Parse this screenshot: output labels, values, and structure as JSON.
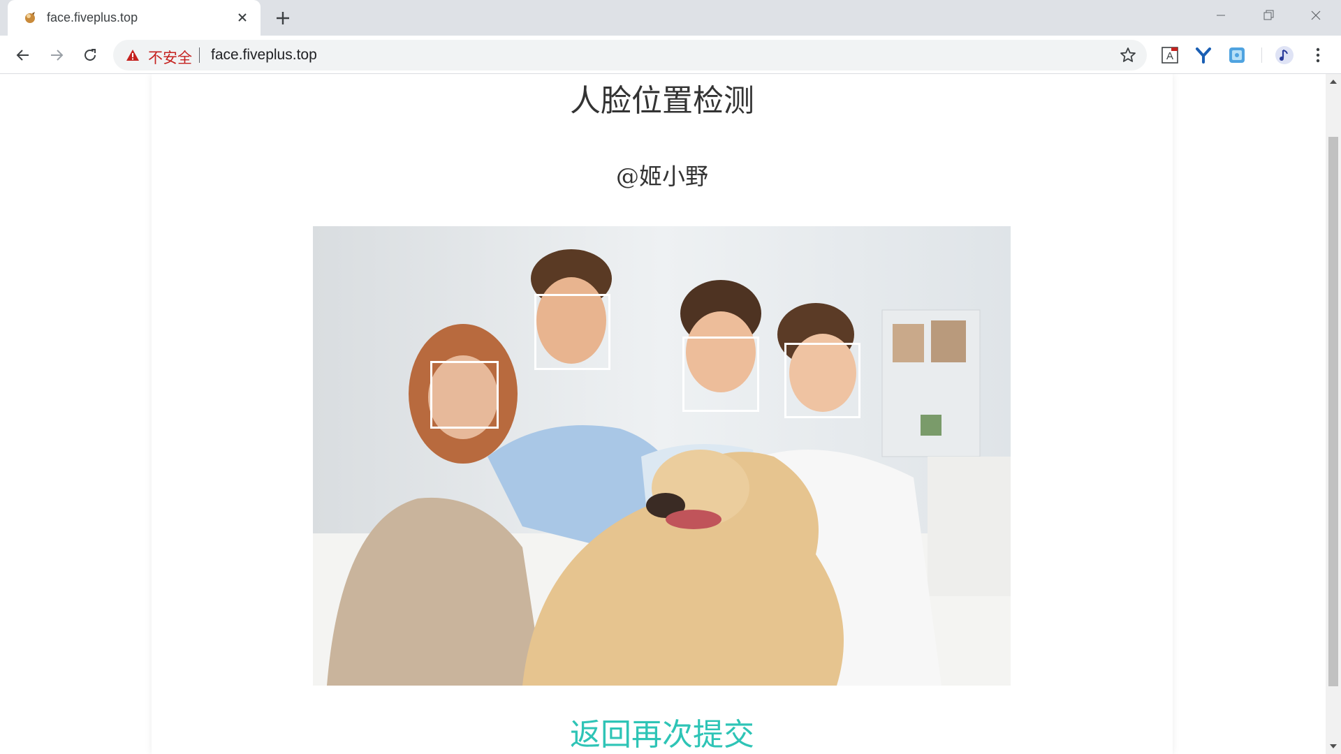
{
  "browser": {
    "tab_title": "face.fiveplus.top",
    "security_label": "不安全",
    "url": "face.fiveplus.top"
  },
  "page": {
    "title": "人脸位置检测",
    "author": "@姬小野",
    "back_link": "返回再次提交"
  },
  "faces_detected": 4,
  "colors": {
    "link": "#2ec4b6",
    "warning": "#c5221f",
    "face_box": "#ffffff"
  },
  "icons": [
    "tab-favicon",
    "close-icon",
    "plus-icon",
    "minimize-icon",
    "restore-icon",
    "window-close-icon",
    "back-arrow-icon",
    "forward-arrow-icon",
    "reload-icon",
    "warning-icon",
    "star-icon",
    "translate-extension-icon",
    "y-extension-icon",
    "image-extension-icon",
    "music-extension-icon",
    "kebab-menu-icon"
  ]
}
